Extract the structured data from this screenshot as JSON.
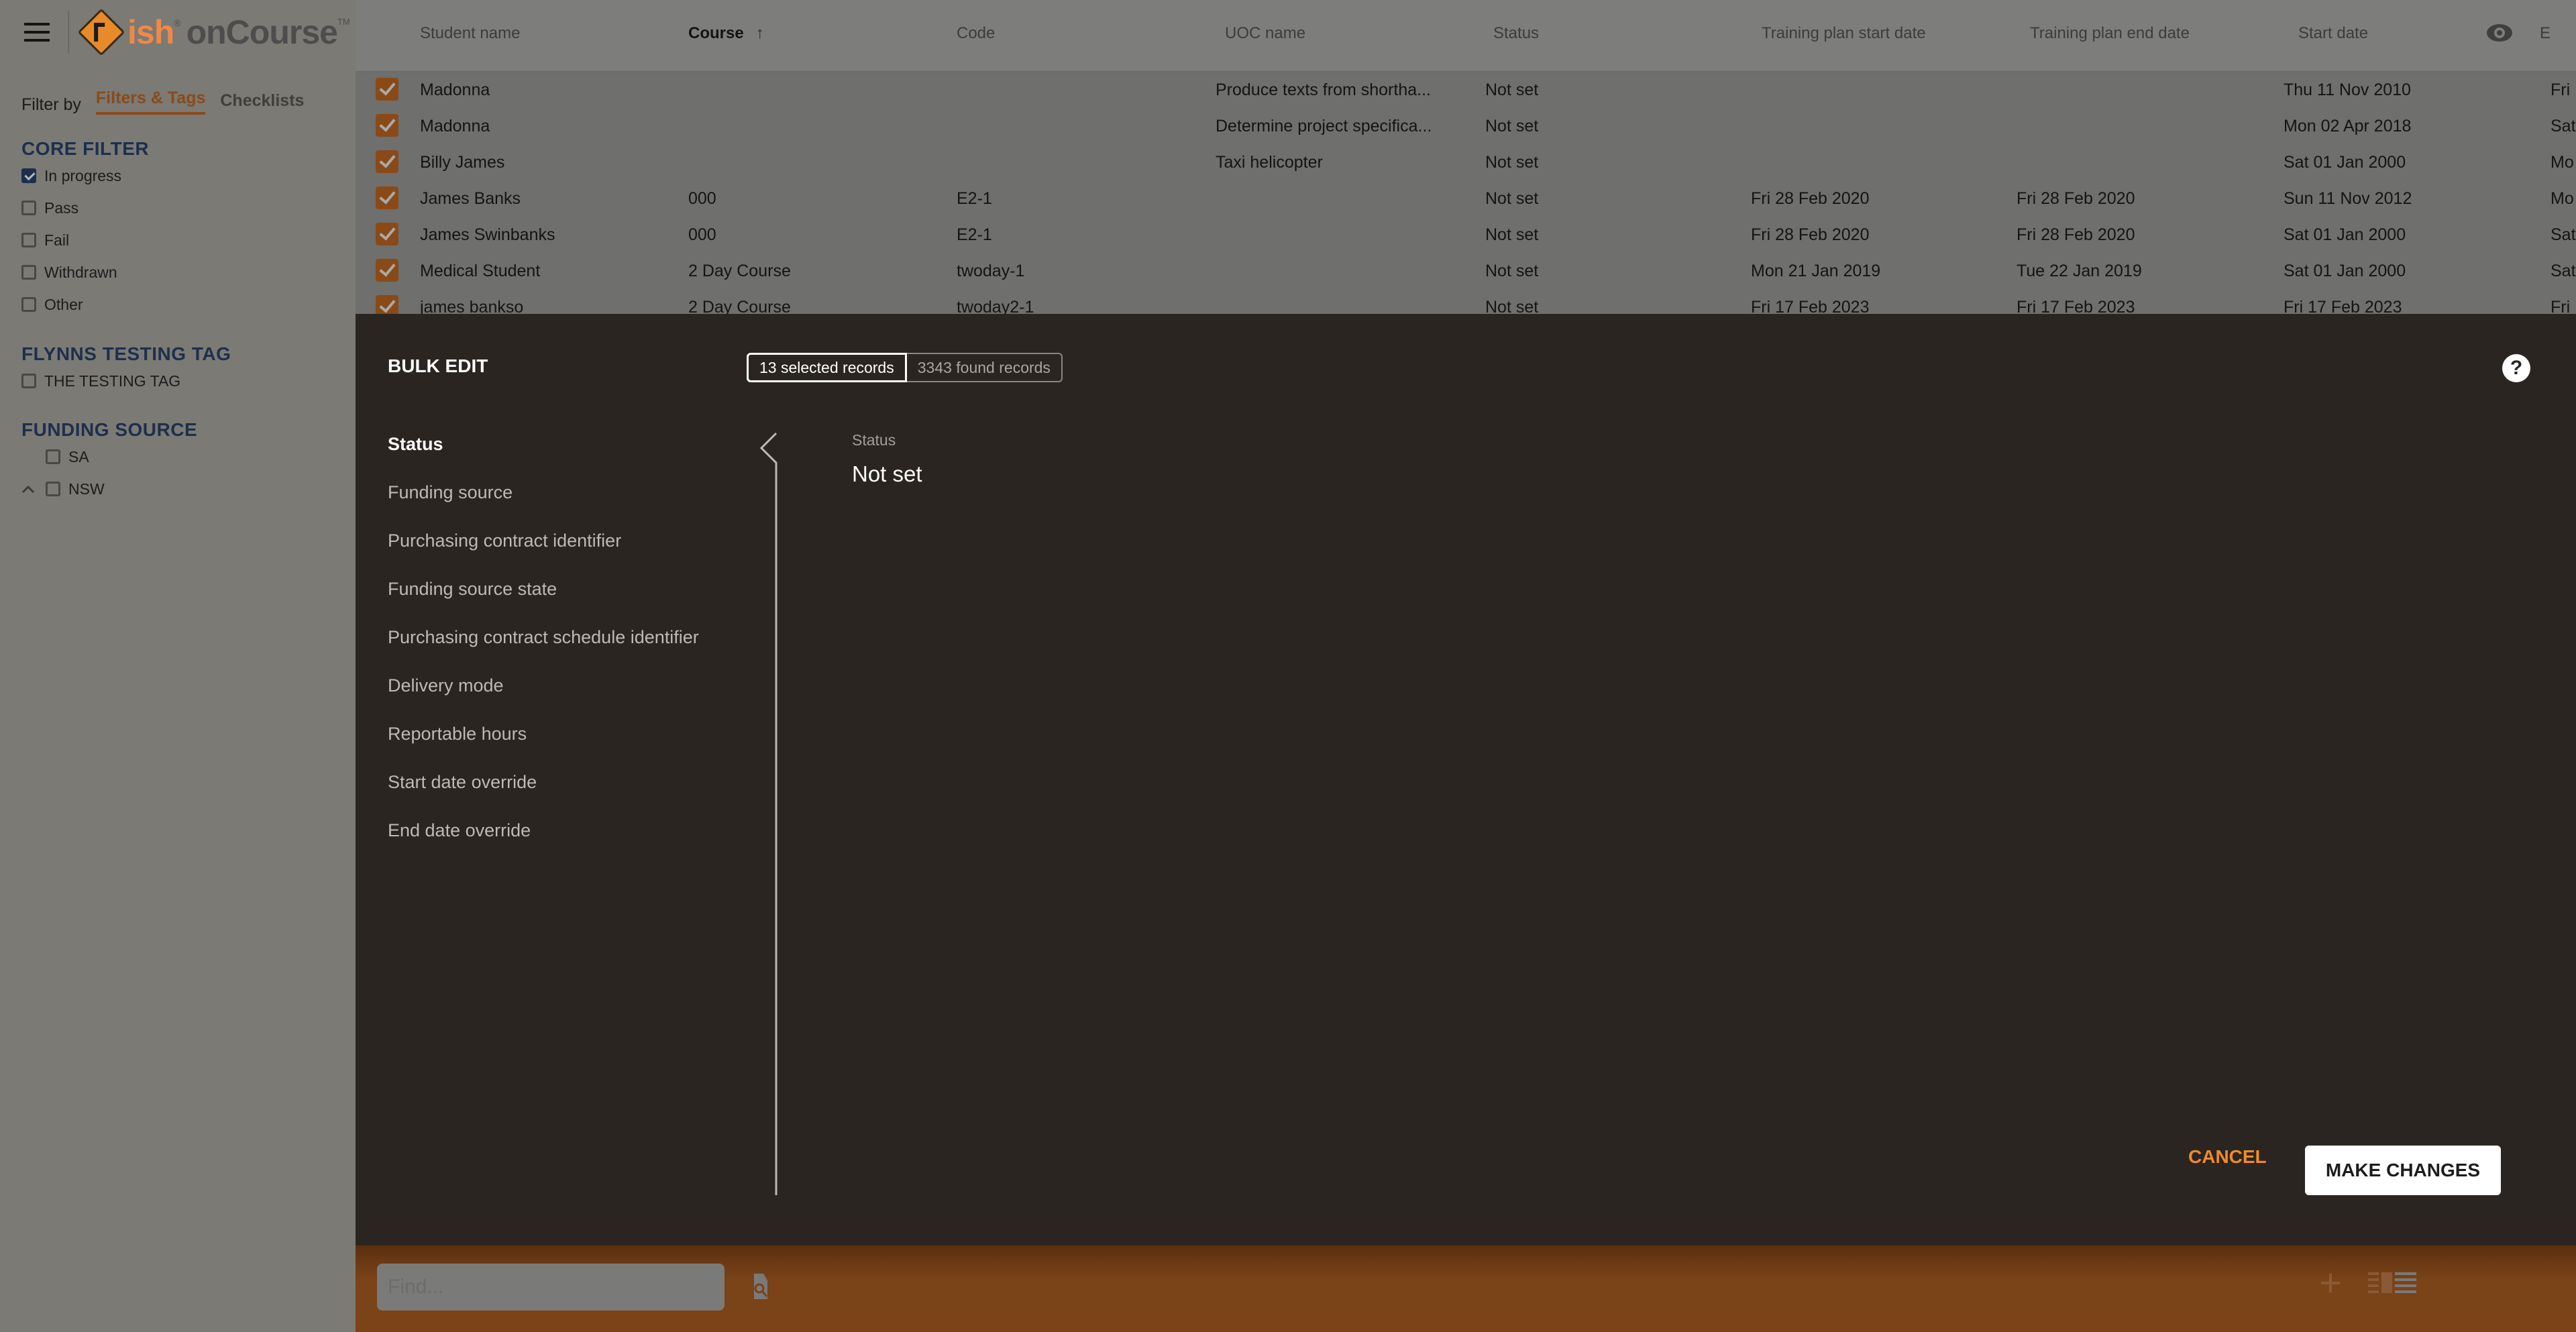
{
  "app": {
    "brand_ish": "ish",
    "brand_oncourse": "onCourse",
    "reg_mark": "®",
    "tm_mark": "TM"
  },
  "sidebar": {
    "filter_by_label": "Filter by",
    "tabs": [
      {
        "label": "Filters & Tags",
        "active": true
      },
      {
        "label": "Checklists",
        "active": false
      }
    ],
    "sections": [
      {
        "title": "CORE FILTER",
        "items": [
          {
            "label": "In progress",
            "checked": true
          },
          {
            "label": "Pass",
            "checked": false
          },
          {
            "label": "Fail",
            "checked": false
          },
          {
            "label": "Withdrawn",
            "checked": false
          },
          {
            "label": "Other",
            "checked": false
          }
        ]
      },
      {
        "title": "FLYNNS TESTING TAG",
        "items": [
          {
            "label": "THE TESTING TAG",
            "checked": false
          }
        ]
      },
      {
        "title": "FUNDING SOURCE",
        "items": [
          {
            "label": "SA",
            "checked": false
          },
          {
            "label": "NSW",
            "checked": false,
            "expandable": true
          }
        ]
      }
    ]
  },
  "table": {
    "columns": [
      "Student name",
      "Course",
      "Code",
      "UOC name",
      "Status",
      "Training plan start date",
      "Training plan end date",
      "Start date",
      "E"
    ],
    "sorted_column": "Course",
    "sort_direction": "ascending",
    "rows": [
      {
        "checked": true,
        "cells": [
          "Madonna",
          "",
          "",
          "Produce texts from shortha...",
          "Not set",
          "",
          "",
          "Thu 11 Nov 2010",
          "Fri"
        ]
      },
      {
        "checked": true,
        "cells": [
          "Madonna",
          "",
          "",
          "Determine project specifica...",
          "Not set",
          "",
          "",
          "Mon 02 Apr 2018",
          "Sat"
        ]
      },
      {
        "checked": true,
        "cells": [
          "Billy James",
          "",
          "",
          "Taxi helicopter",
          "Not set",
          "",
          "",
          "Sat 01 Jan 2000",
          "Mo"
        ]
      },
      {
        "checked": true,
        "cells": [
          "James Banks",
          "000",
          "E2-1",
          "",
          "Not set",
          "Fri 28 Feb 2020",
          "Fri 28 Feb 2020",
          "Sun 11 Nov 2012",
          "Mo"
        ]
      },
      {
        "checked": true,
        "cells": [
          "James Swinbanks",
          "000",
          "E2-1",
          "",
          "Not set",
          "Fri 28 Feb 2020",
          "Fri 28 Feb 2020",
          "Sat 01 Jan 2000",
          "Sat"
        ]
      },
      {
        "checked": true,
        "cells": [
          "Medical Student",
          "2 Day Course",
          "twoday-1",
          "",
          "Not set",
          "Mon 21 Jan 2019",
          "Tue 22 Jan 2019",
          "Sat 01 Jan 2000",
          "Sat"
        ]
      },
      {
        "checked": true,
        "cells": [
          "james bankso",
          "2 Day Course",
          "twoday2-1",
          "",
          "Not set",
          "Fri 17 Feb 2023",
          "Fri 17 Feb 2023",
          "Fri 17 Feb 2023",
          "Fri"
        ]
      }
    ]
  },
  "modal": {
    "title": "BULK EDIT",
    "selected_records": "13 selected records",
    "found_records": "3343 found records",
    "help_icon": "?",
    "fields": [
      {
        "label": "Status",
        "active": true
      },
      {
        "label": "Funding source",
        "active": false
      },
      {
        "label": "Purchasing contract identifier",
        "active": false
      },
      {
        "label": "Funding source state",
        "active": false
      },
      {
        "label": "Purchasing contract schedule identifier",
        "active": false
      },
      {
        "label": "Delivery mode",
        "active": false
      },
      {
        "label": "Reportable hours",
        "active": false
      },
      {
        "label": "Start date override",
        "active": false
      },
      {
        "label": "End date override",
        "active": false
      }
    ],
    "editor": {
      "label": "Status",
      "value": "Not set"
    },
    "cancel_label": "CANCEL",
    "submit_label": "MAKE CHANGES"
  },
  "bottombar": {
    "find_placeholder": "Find...",
    "find_value": ""
  },
  "colors": {
    "accent_orange": "#f08a2c",
    "modal_bg": "#2a2520",
    "filter_heading": "#1e2f4e"
  }
}
